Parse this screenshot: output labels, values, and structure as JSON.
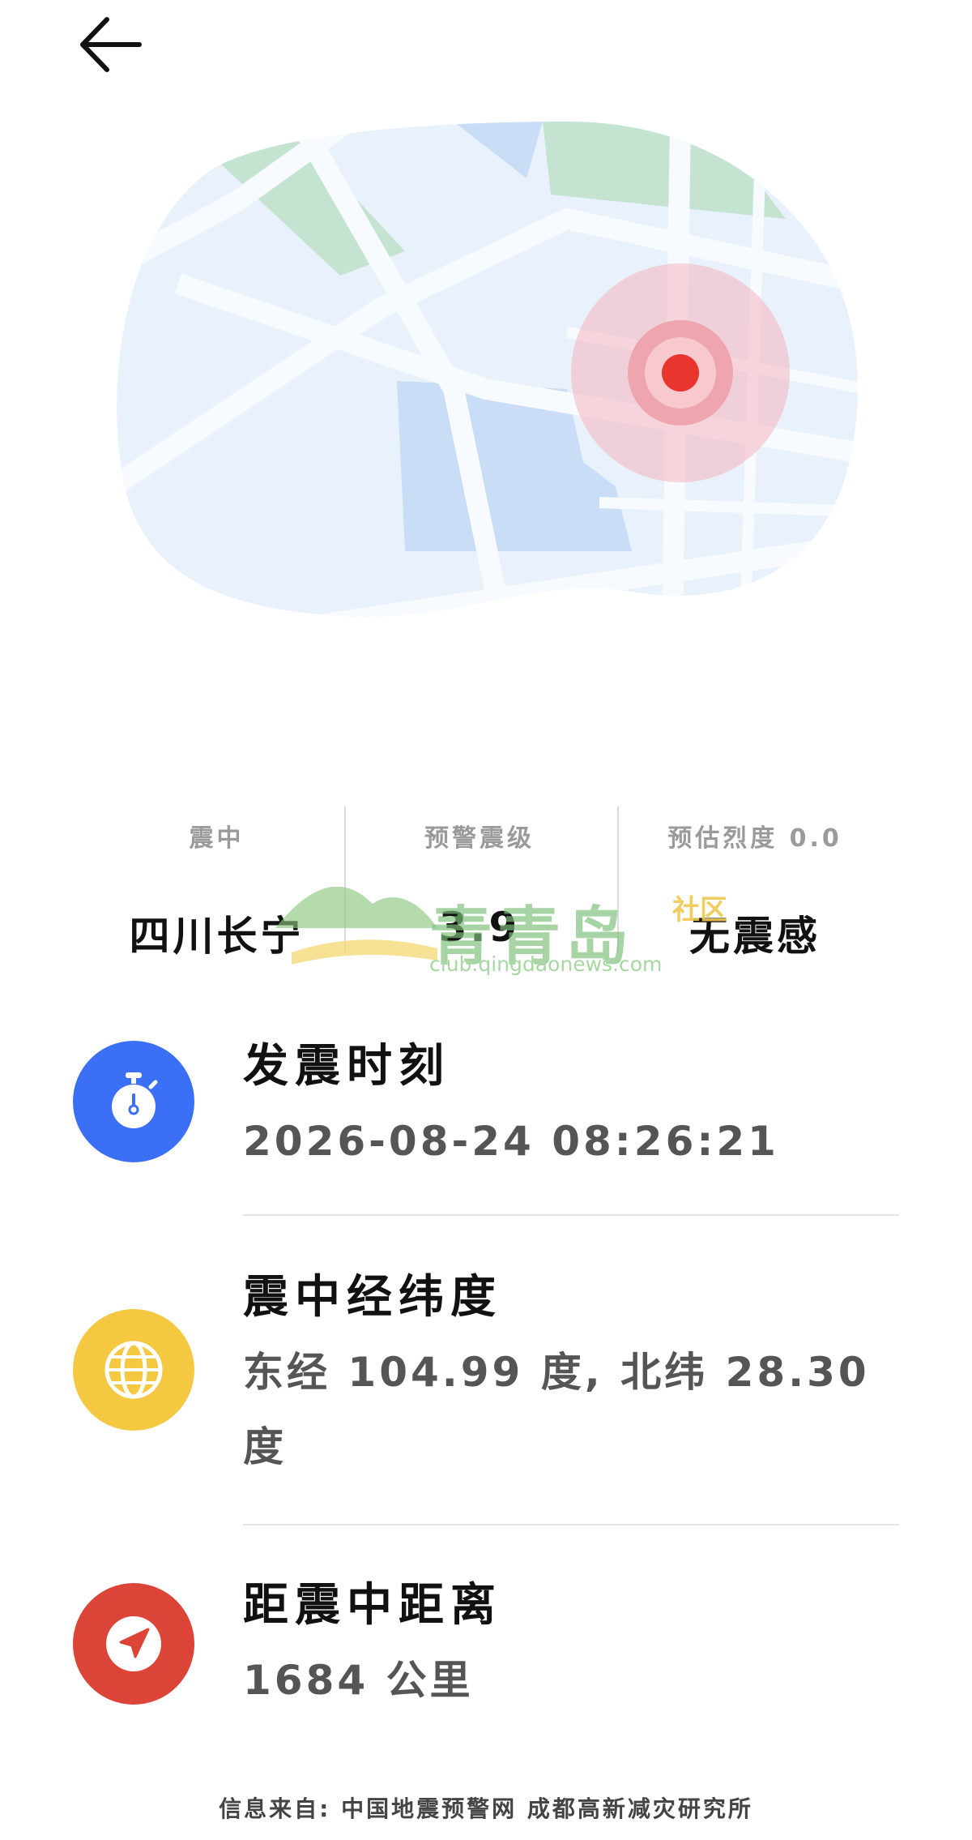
{
  "nav": {
    "back_icon": "arrow-left-icon"
  },
  "stats": [
    {
      "label": "震中",
      "value": "四川长宁"
    },
    {
      "label": "预警震级",
      "value": "3.9"
    },
    {
      "label": "预估烈度 0.0",
      "value": "无震感"
    }
  ],
  "watermark": {
    "text": "青青岛",
    "sub": "社区",
    "url": "club.qingdaonews.com"
  },
  "info": {
    "time": {
      "title": "发震时刻",
      "value": "2026-08-24 08:26:21",
      "icon": "stopwatch-icon",
      "color": "#3b6ff5"
    },
    "coords": {
      "title": "震中经纬度",
      "value": "东经 104.99 度, 北纬 28.30 度",
      "icon": "globe-icon",
      "color": "#f5c842"
    },
    "distance": {
      "title": "距震中距离",
      "value": "1684 公里",
      "icon": "navigation-arrow-icon",
      "color": "#db4437"
    }
  },
  "footer": {
    "text": "信息来自: 中国地震预警网 成都高新减灾研究所"
  }
}
